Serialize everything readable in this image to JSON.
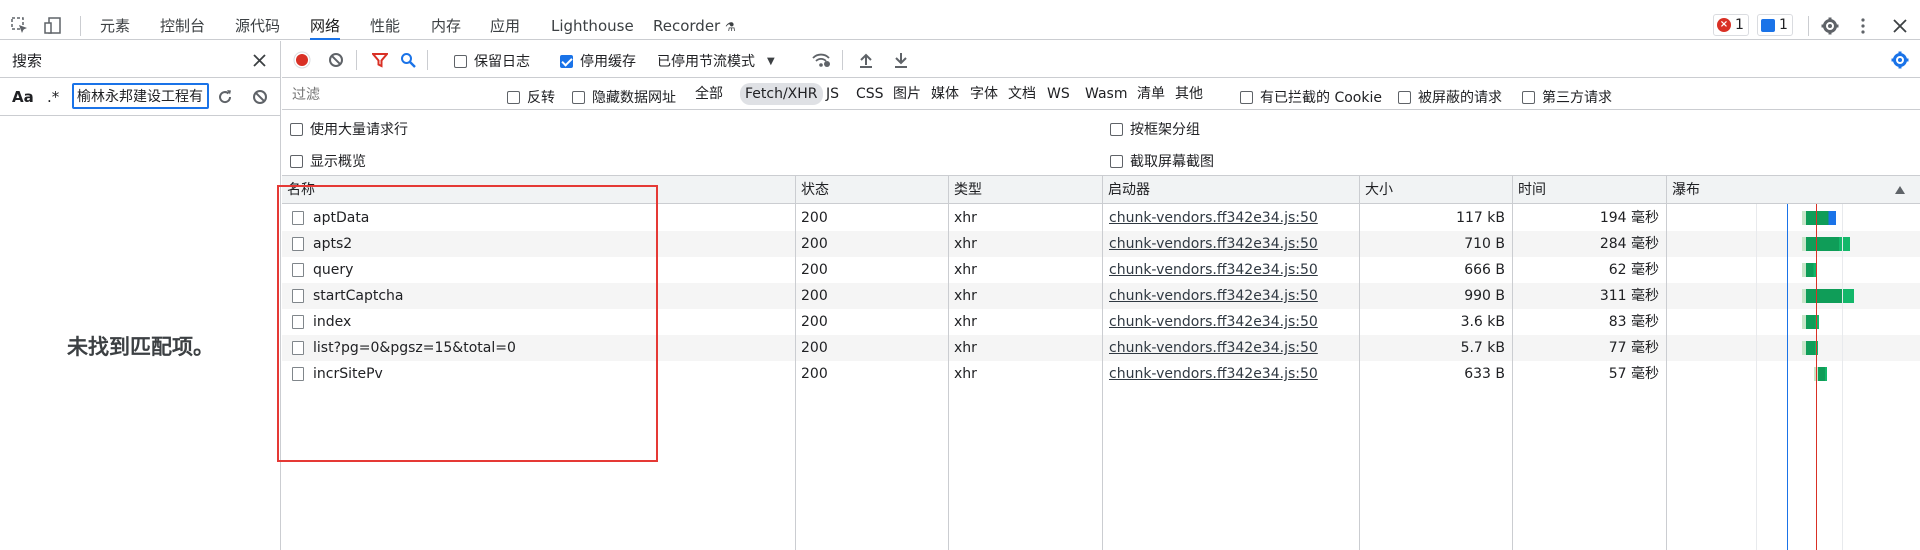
{
  "devtools": {
    "top_tabs": [
      "元素",
      "控制台",
      "源代码",
      "网络",
      "性能",
      "内存",
      "应用",
      "Lighthouse",
      "Recorder"
    ],
    "active_tab": "网络",
    "error_count": "1",
    "message_count": "1"
  },
  "search_panel": {
    "title": "搜索",
    "match_case_label": "Aa",
    "regex_label": ".*",
    "query": "榆林永邦建设工程有",
    "empty_message": "未找到匹配项。"
  },
  "network": {
    "preserve_log_label": "保留日志",
    "disable_cache_label": "停用缓存",
    "throttling_value": "已停用节流模式",
    "filter_placeholder": "过滤",
    "invert_label": "反转",
    "hide_data_urls_label": "隐藏数据网址",
    "type_filters": [
      "全部",
      "Fetch/XHR",
      "JS",
      "CSS",
      "图片",
      "媒体",
      "字体",
      "文档",
      "WS",
      "Wasm",
      "清单",
      "其他"
    ],
    "active_type": "Fetch/XHR",
    "blocked_cookies_label": "有已拦截的 Cookie",
    "blocked_requests_label": "被屏蔽的请求",
    "third_party_label": "第三方请求",
    "big_rows_label": "使用大量请求行",
    "overview_label": "显示概览",
    "group_by_frame_label": "按框架分组",
    "capture_screenshots_label": "截取屏幕截图",
    "columns": [
      "名称",
      "状态",
      "类型",
      "启动器",
      "大小",
      "时间",
      "瀑布"
    ],
    "rows": [
      {
        "name": "aptData",
        "status": "200",
        "type": "xhr",
        "initiator": "chunk-vendors.ff342e34.js:50",
        "size": "117 kB",
        "time": "194 毫秒"
      },
      {
        "name": "apts2",
        "status": "200",
        "type": "xhr",
        "initiator": "chunk-vendors.ff342e34.js:50",
        "size": "710 B",
        "time": "284 毫秒"
      },
      {
        "name": "query",
        "status": "200",
        "type": "xhr",
        "initiator": "chunk-vendors.ff342e34.js:50",
        "size": "666 B",
        "time": "62 毫秒"
      },
      {
        "name": "startCaptcha",
        "status": "200",
        "type": "xhr",
        "initiator": "chunk-vendors.ff342e34.js:50",
        "size": "990 B",
        "time": "311 毫秒"
      },
      {
        "name": "index",
        "status": "200",
        "type": "xhr",
        "initiator": "chunk-vendors.ff342e34.js:50",
        "size": "3.6 kB",
        "time": "83 毫秒"
      },
      {
        "name": "list?pg=0&pgsz=15&total=0",
        "status": "200",
        "type": "xhr",
        "initiator": "chunk-vendors.ff342e34.js:50",
        "size": "5.7 kB",
        "time": "77 毫秒"
      },
      {
        "name": "incrSitePv",
        "status": "200",
        "type": "xhr",
        "initiator": "chunk-vendors.ff342e34.js:50",
        "size": "633 B",
        "time": "57 毫秒"
      }
    ]
  },
  "colors": {
    "accent": "#1a73e8",
    "record_red": "#d93025",
    "annotation_red": "#e53935",
    "waterfall_green": "#0f9d58",
    "waterfall_blue": "#1a73e8"
  }
}
